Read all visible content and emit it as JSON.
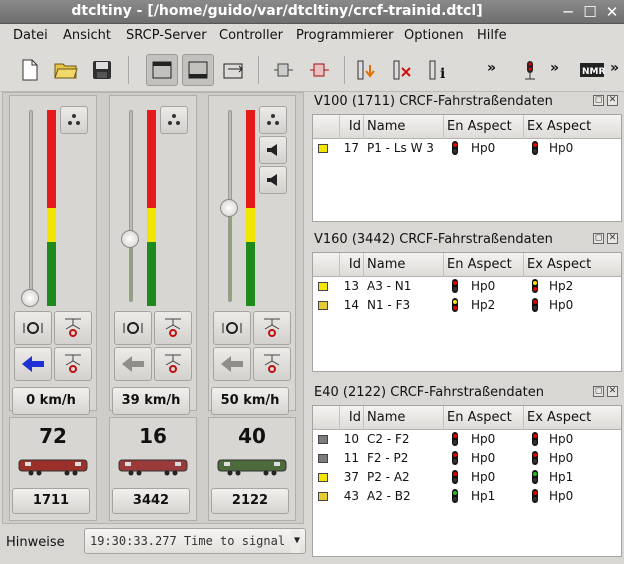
{
  "window": {
    "title": "dtclt­iny - [/home/guido/var/dtcltiny/crcf-trainid.dtcl]"
  },
  "menu": [
    "Datei",
    "Ansicht",
    "SRCP-Server",
    "Controller",
    "Programmierer",
    "Optionen",
    "Hilfe"
  ],
  "toolbar": {
    "overflow": "»"
  },
  "locos": [
    {
      "speed": "0 km/h",
      "number": "72",
      "address": "1711",
      "level": 0.0,
      "dir_active": true,
      "color": "#9b2f2a"
    },
    {
      "speed": "39 km/h",
      "number": "16",
      "address": "3442",
      "level": 0.33,
      "dir_active": false,
      "color": "#9b3a3a"
    },
    {
      "speed": "50 km/h",
      "number": "40",
      "address": "2122",
      "level": 0.5,
      "dir_active": false,
      "color": "#4c6a3c"
    }
  ],
  "status": {
    "label": "Hinweise",
    "message": "19:30:33.277 Time to signal"
  },
  "panels": [
    {
      "title": "V100 (1711) CRCF-Fahrstraßendaten",
      "rows": [
        {
          "color": "#f2e600",
          "id": "17",
          "name": "P1 - Ls W 3",
          "en": "Hp0",
          "ex": "Hp0",
          "en_light": "#e00000",
          "ex_light": "#e00000"
        }
      ]
    },
    {
      "title": "V160 (3442) CRCF-Fahrstraßendaten",
      "rows": [
        {
          "color": "#f2e600",
          "id": "13",
          "name": "A3 - N1",
          "en": "Hp0",
          "ex": "Hp2",
          "en_light": "#e00000",
          "ex_light": "#f2e600"
        },
        {
          "color": "#e6cc30",
          "id": "14",
          "name": "N1 - F3",
          "en": "Hp2",
          "ex": "Hp0",
          "en_light": "#f2e600",
          "ex_light": "#e00000"
        }
      ]
    },
    {
      "title": "E40 (2122) CRCF-Fahrstraßendaten",
      "rows": [
        {
          "color": "#7c7c7c",
          "id": "10",
          "name": "C2 - F2",
          "en": "Hp0",
          "ex": "Hp0",
          "en_light": "#e00000",
          "ex_light": "#e00000"
        },
        {
          "color": "#7c7c7c",
          "id": "11",
          "name": "F2 - P2",
          "en": "Hp0",
          "ex": "Hp0",
          "en_light": "#e00000",
          "ex_light": "#e00000"
        },
        {
          "color": "#f2e600",
          "id": "37",
          "name": "P2 - A2",
          "en": "Hp0",
          "ex": "Hp1",
          "en_light": "#e00000",
          "ex_light": "#20c020"
        },
        {
          "color": "#e6cc30",
          "id": "43",
          "name": "A2 - B2",
          "en": "Hp1",
          "ex": "Hp0",
          "en_light": "#20c020",
          "ex_light": "#e00000"
        }
      ]
    }
  ],
  "columns": {
    "id": "Id",
    "name": "Name",
    "en": "En Aspect",
    "ex": "Ex Aspect"
  }
}
